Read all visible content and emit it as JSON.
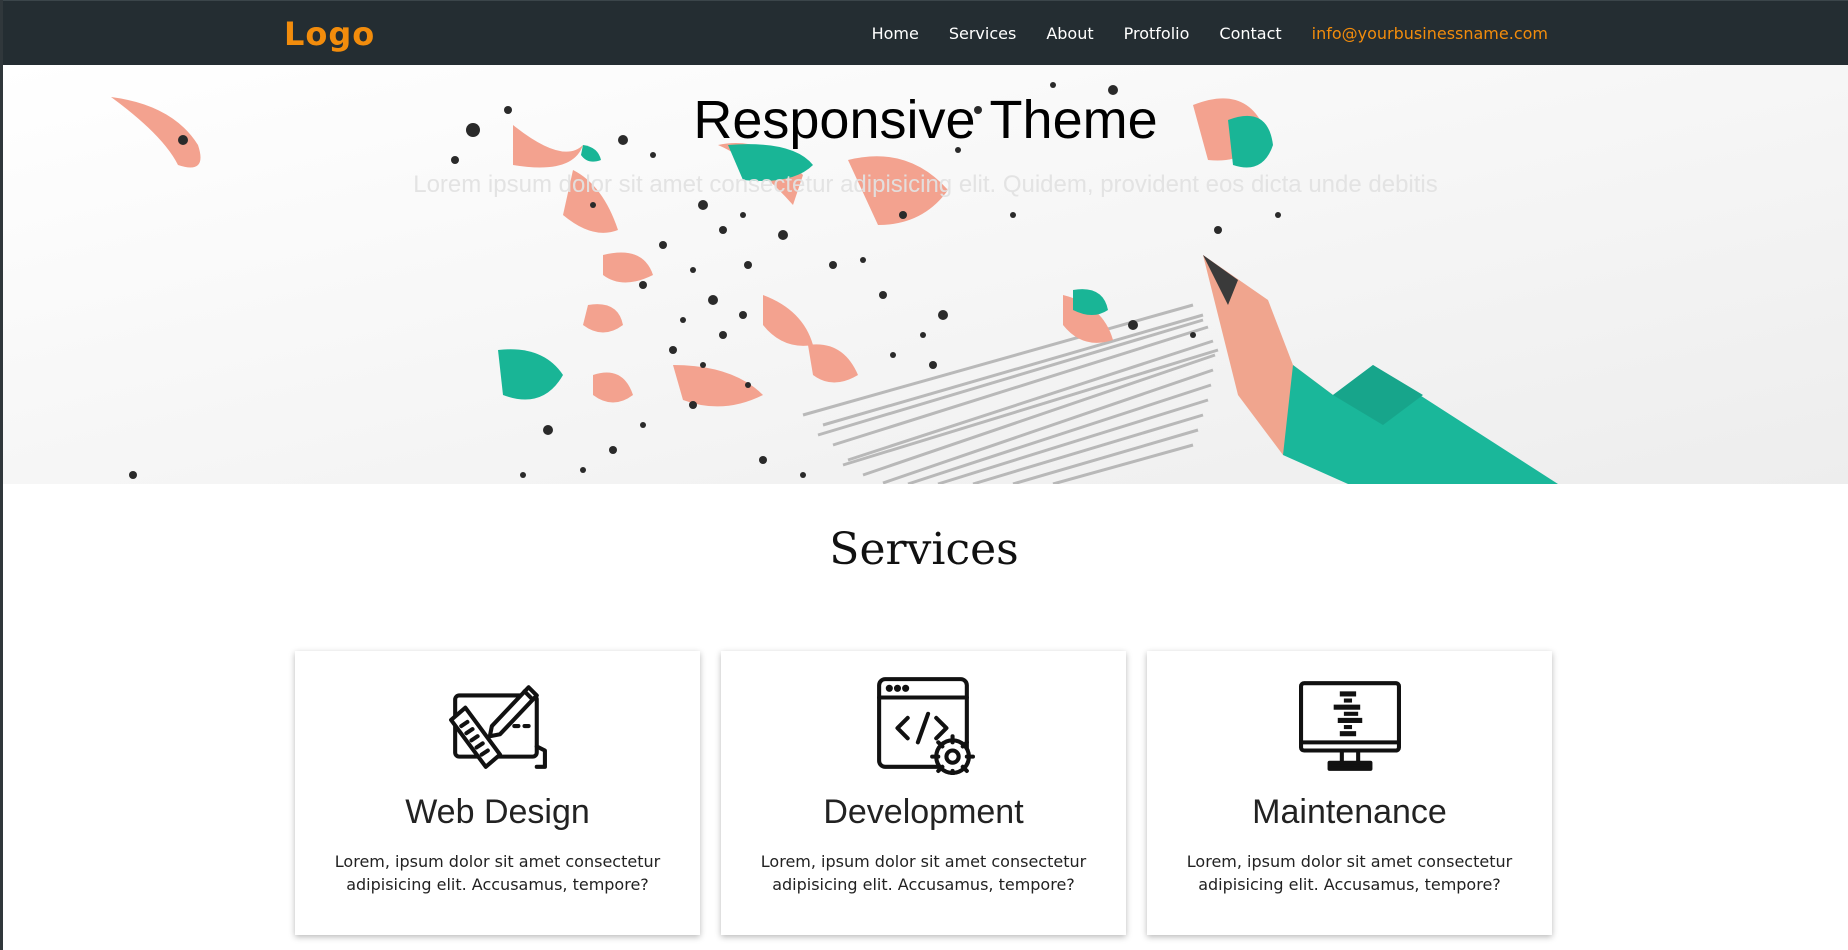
{
  "navbar": {
    "logo": "Logo",
    "links": [
      "Home",
      "Services",
      "About",
      "Protfolio",
      "Contact"
    ],
    "email": "info@yourbusinessname.com"
  },
  "hero": {
    "title": "Responsive Theme",
    "subtitle": "Lorem ipsum dolor sit amet consectetur adipisicing elit. Quidem, provident eos dicta unde debitis"
  },
  "services": {
    "title": "Services",
    "cards": [
      {
        "title": "Web Design",
        "text": "Lorem, ipsum dolor sit amet consectetur adipisicing elit. Accusamus, tempore?",
        "icon": "design-tools-icon"
      },
      {
        "title": "Development",
        "text": "Lorem, ipsum dolor sit amet consectetur adipisicing elit. Accusamus, tempore?",
        "icon": "code-window-gear-icon"
      },
      {
        "title": "Maintenance",
        "text": "Lorem, ipsum dolor sit amet consectetur adipisicing elit. Accusamus, tempore?",
        "icon": "monitor-icon"
      }
    ]
  },
  "colors": {
    "navbar": "#242d32",
    "accent": "#f28c0c",
    "pencil_teal": "#1ab79a",
    "pencil_wood": "#f0a58e"
  }
}
